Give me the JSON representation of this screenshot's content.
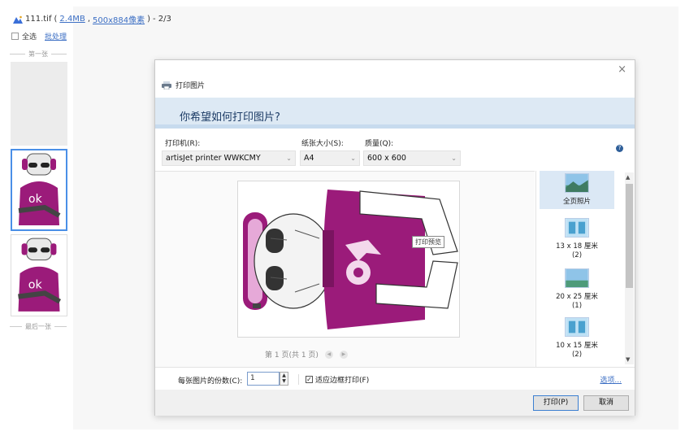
{
  "viewer": {
    "file_name": "111.tif",
    "file_size": "2.4MB",
    "separator": ",",
    "dimensions": "500x884像素",
    "position_text": "- 2/3",
    "select_all_label": "全选",
    "batch_label": "批处理",
    "first_label": "第一张",
    "last_label": "最后一张"
  },
  "dialog": {
    "title": "打印图片",
    "close_glyph": "×",
    "question": "你希望如何打印图片?",
    "printer_label": "打印机(R):",
    "printer_value": "artisJet printer WWKCMY",
    "paper_label": "纸张大小(S):",
    "paper_value": "A4",
    "quality_label": "质量(Q):",
    "quality_value": "600 x 600",
    "preview_tooltip": "打印预览",
    "page_info": "第 1 页(共 1 页)",
    "layouts": [
      {
        "name": "全页照片"
      },
      {
        "name": "13 x 18 厘米",
        "count": "(2)"
      },
      {
        "name": "20 x 25 厘米",
        "count": "(1)"
      },
      {
        "name": "10 x 15 厘米",
        "count": "(2)"
      }
    ],
    "copies_label": "每张图片的份数(C):",
    "copies_value": "1",
    "fit_label": "适应边框打印(F)",
    "fit_checked": true,
    "options_link": "选项...",
    "print_button": "打印(P)",
    "cancel_button": "取消"
  },
  "colors": {
    "accent": "#4a8fe7",
    "shirt": "#9b1b7a",
    "header_band": "#dde9f4"
  },
  "icons": [
    "app-logo-icon",
    "printer-icon",
    "help-icon",
    "close-icon",
    "chevron-down-icon",
    "spinner-arrows-icon"
  ]
}
